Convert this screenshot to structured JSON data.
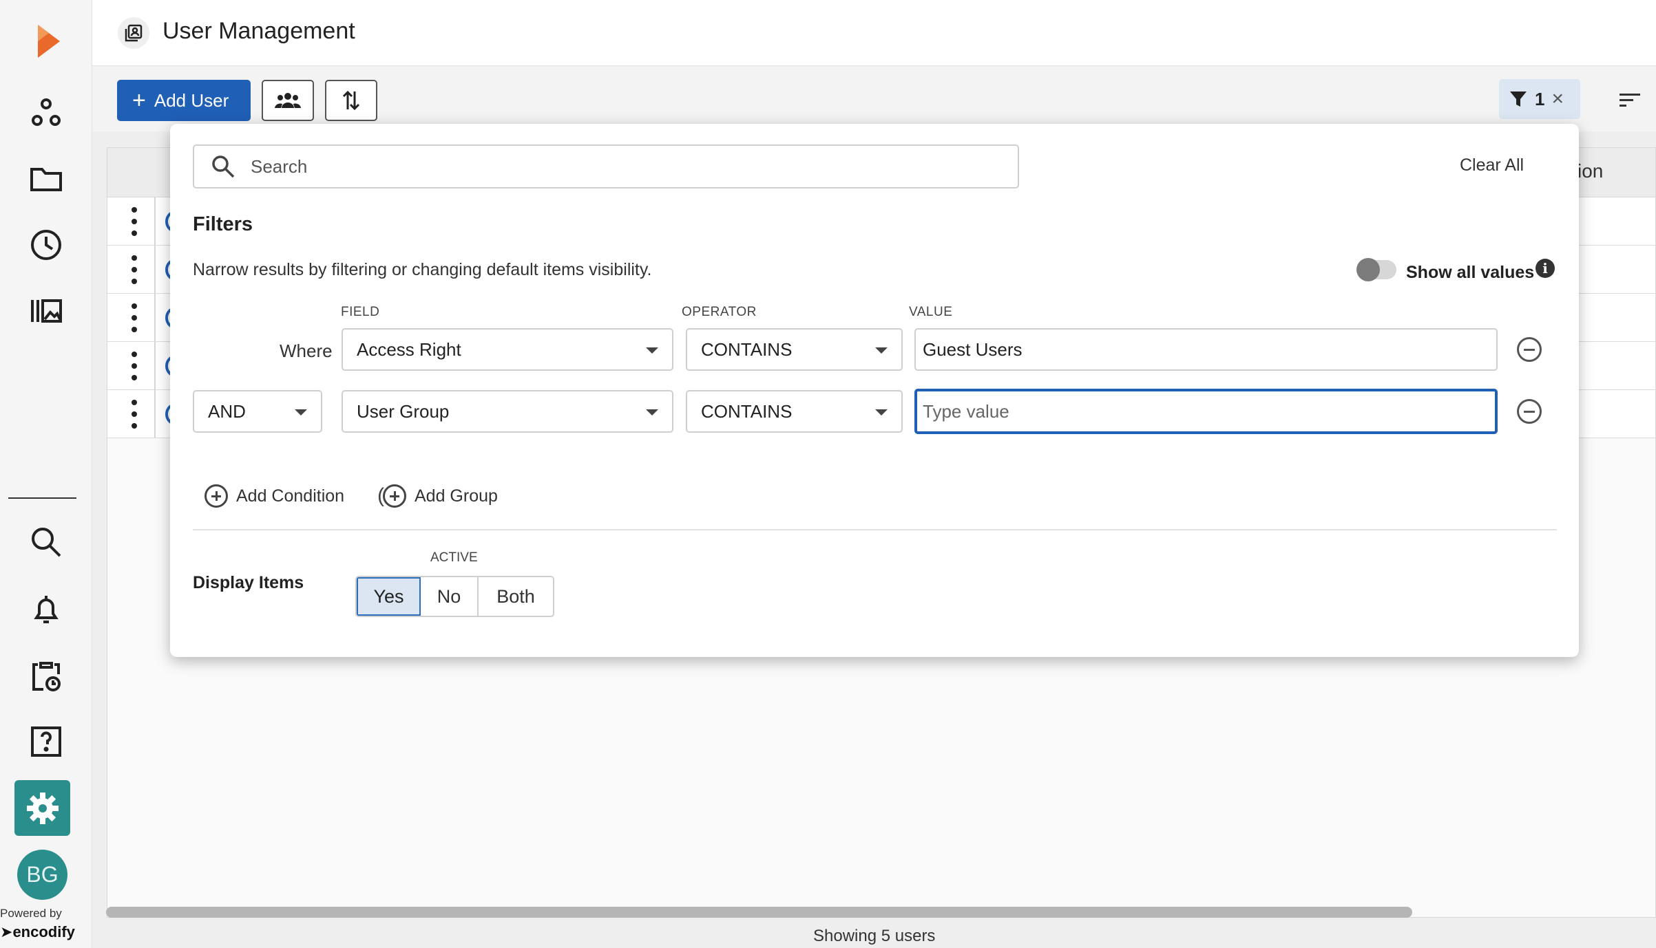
{
  "header": {
    "title": "User Management"
  },
  "toolbar": {
    "add_user_label": "Add User",
    "filter_count": "1"
  },
  "table": {
    "partial_header": "ion",
    "row_count": 5,
    "footer": "Showing 5 users"
  },
  "sidebar": {
    "avatar_initials": "BG",
    "powered_by": "Powered by",
    "brand": "encodify"
  },
  "filter_panel": {
    "search_placeholder": "Search",
    "clear_all": "Clear All",
    "title": "Filters",
    "description": "Narrow results by filtering or changing default items visibility.",
    "show_all_values_label": "Show all values",
    "show_all_values_on": false,
    "col_field": "FIELD",
    "col_operator": "OPERATOR",
    "col_value": "VALUE",
    "conditions": [
      {
        "connector": "Where",
        "field": "Access Right",
        "operator": "CONTAINS",
        "value": "Guest Users"
      },
      {
        "connector": "AND",
        "field": "User Group",
        "operator": "CONTAINS",
        "value": "",
        "value_placeholder": "Type value"
      }
    ],
    "add_condition": "Add Condition",
    "add_group": "Add Group",
    "display_items_label": "Display Items",
    "active_label": "ACTIVE",
    "active_options": [
      "Yes",
      "No",
      "Both"
    ],
    "active_selected": "Yes"
  },
  "colors": {
    "primary": "#1f5fb5",
    "teal": "#2a8f8c",
    "logo_orange": "#e8692a",
    "chip_bg": "#dbe6f2"
  }
}
